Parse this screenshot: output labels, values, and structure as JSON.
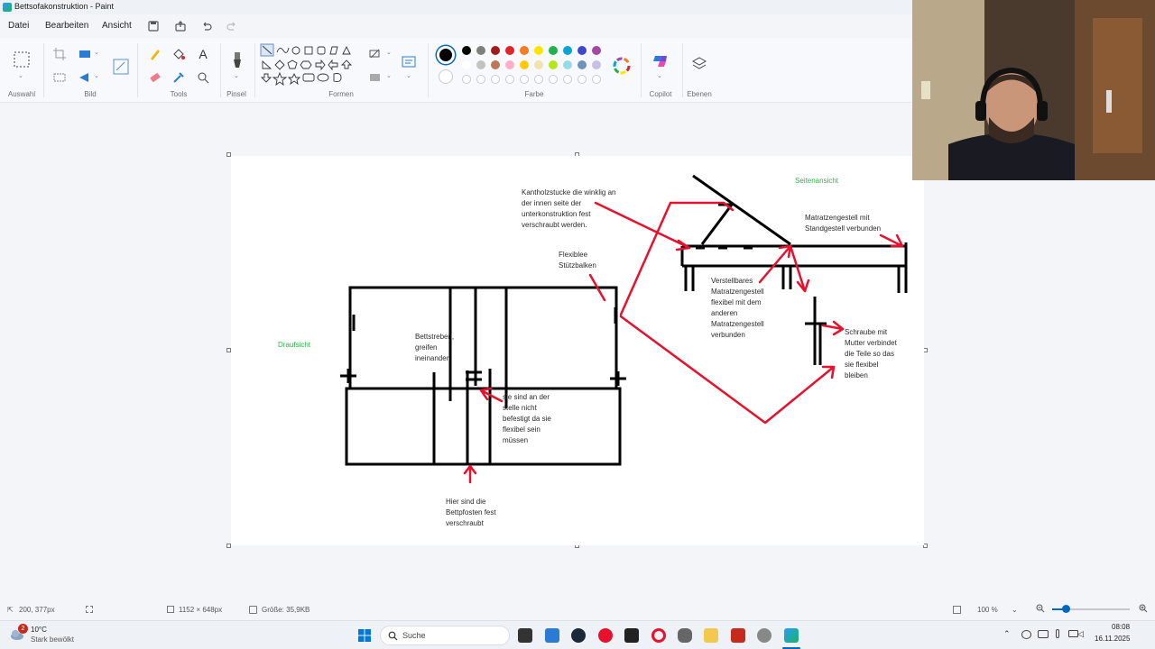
{
  "window": {
    "title": "Bettsofakonstruktion - Paint"
  },
  "menu": {
    "items": [
      "Datei",
      "Bearbeiten",
      "Ansicht"
    ]
  },
  "ribbon": {
    "groups": {
      "auswahl": "Auswahl",
      "bild": "Bild",
      "tools": "Tools",
      "pinsel": "Pinsel",
      "formen": "Formen",
      "farbe": "Farbe",
      "copilot": "Copilot",
      "ebenen": "Ebenen"
    },
    "palette_row1": [
      "#000000",
      "#7f7f7f",
      "#a01c1c",
      "#e2232c",
      "#f17e24",
      "#fde500",
      "#22b14c",
      "#0aa3d5",
      "#3f48cc",
      "#a349a4"
    ],
    "palette_row2": [
      "#ffffff",
      "#c3c3c3",
      "#b97a57",
      "#ffaec9",
      "#ffc90e",
      "#efe4b0",
      "#b5e61d",
      "#99d9ea",
      "#7092be",
      "#c8bfe7"
    ],
    "primary_color": "#000000",
    "secondary_color": "#ffffff"
  },
  "drawing": {
    "notes": {
      "kantholz": "Kantholzstucke die winklig an\nder innen seite der\nunterkonstruktion fest\nverschraubt werden.",
      "seitenansicht": "Seitenansicht",
      "matratzengestell": "Matratzengestell mit\nStandgestell verbunden",
      "flexiblee": "Flexiblee\nStützbalken",
      "verstellbares": "Verstellbares\nMatratzengestell\nflexibel mit dem\nanderen\nMatratzengestell\nverbunden",
      "draufsicht": "Draufsicht",
      "bettstreben": "Bettstreben,\ngreifen\nineinander",
      "schraube": "Schraube mit\nMutter verbindet\ndie Teile so das\nsie flexibel\nbleiben",
      "nicht_befestigt": "sie sind an der\nstelle nicht\nbefestigt da sie\nflexibel sein\nmüssen",
      "bettpfosten": "Hier sind die\nBettpfosten fest\nverschraubt"
    }
  },
  "status": {
    "cursor_pos": "200, 377px",
    "canvas_size": "1152 × 648px",
    "file_size": "Größe: 35,9KB",
    "zoom": "100 %"
  },
  "taskbar": {
    "weather_temp": "10°C",
    "weather_desc": "Stark bewölkt",
    "weather_badge": "2",
    "search_placeholder": "Suche",
    "time": "08:08",
    "date": "16.11.2025"
  },
  "colors": {
    "red_annotation": "#e8112d",
    "green_label": "#2fb34a",
    "accent": "#0067c0"
  }
}
